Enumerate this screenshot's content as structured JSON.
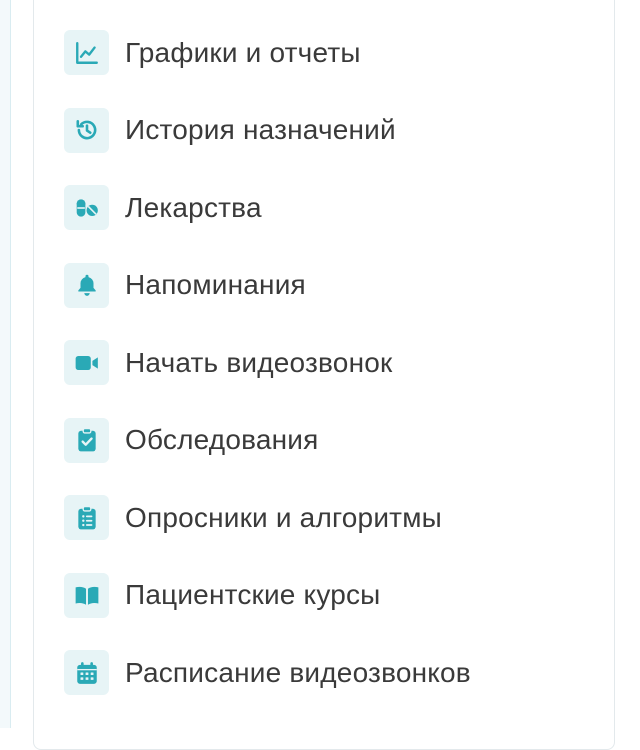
{
  "accent_color": "#2aa9b6",
  "menu": {
    "items": [
      {
        "label": "Графики и отчеты",
        "icon": "line-chart-icon"
      },
      {
        "label": "История назначений",
        "icon": "history-icon"
      },
      {
        "label": "Лекарства",
        "icon": "pills-icon"
      },
      {
        "label": "Напоминания",
        "icon": "bell-icon"
      },
      {
        "label": "Начать видеозвонок",
        "icon": "video-camera-icon"
      },
      {
        "label": "Обследования",
        "icon": "clipboard-check-icon"
      },
      {
        "label": "Опросники и алгоритмы",
        "icon": "clipboard-list-icon"
      },
      {
        "label": "Пациентские курсы",
        "icon": "open-book-icon"
      },
      {
        "label": "Расписание видеозвонков",
        "icon": "calendar-icon"
      }
    ]
  }
}
